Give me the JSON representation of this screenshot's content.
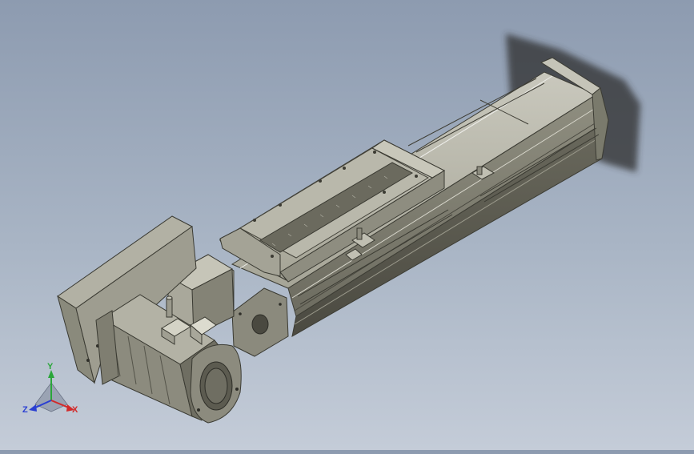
{
  "viewport": {
    "background_top": "#8d9bb0",
    "background_bottom": "#c4ccd8",
    "model": "linear-actuator-with-servo-motor"
  },
  "triad": {
    "x_label": "X",
    "y_label": "Y",
    "z_label": "Z",
    "x_color": "#d22a2a",
    "y_color": "#2aa63a",
    "z_color": "#2a3fd2"
  }
}
